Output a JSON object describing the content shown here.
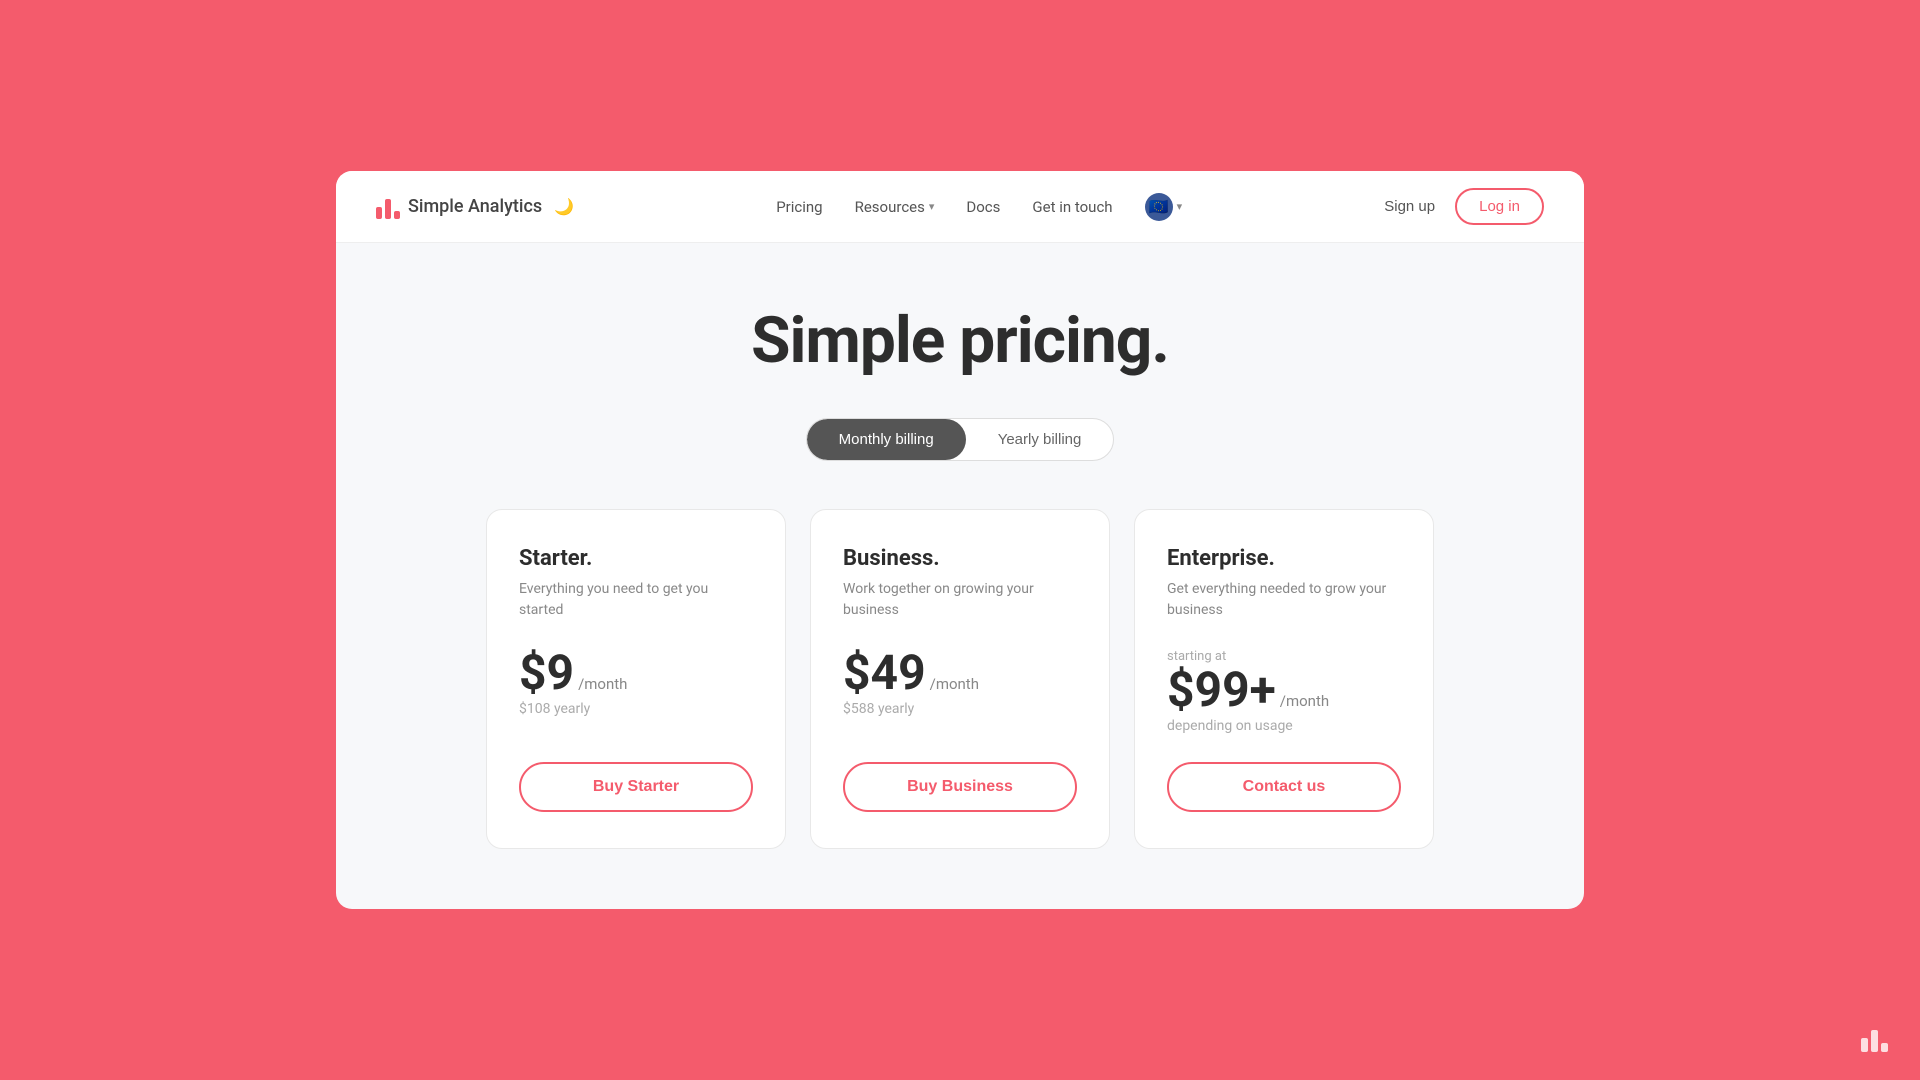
{
  "brand": {
    "name": "Simple Analytics",
    "logo_alt": "Simple Analytics logo"
  },
  "nav": {
    "items": [
      {
        "label": "Pricing",
        "has_dropdown": false
      },
      {
        "label": "Resources",
        "has_dropdown": true
      },
      {
        "label": "Docs",
        "has_dropdown": false
      },
      {
        "label": "Get in touch",
        "has_dropdown": false
      }
    ],
    "language": "🇪🇺",
    "sign_up": "Sign up",
    "log_in": "Log in"
  },
  "page": {
    "title": "Simple pricing."
  },
  "billing_toggle": {
    "monthly_label": "Monthly billing",
    "yearly_label": "Yearly billing",
    "active": "monthly"
  },
  "plans": [
    {
      "name": "Starter.",
      "description": "Everything you need to get you started",
      "price": "$9",
      "period": "/month",
      "yearly_note": "$108 yearly",
      "starting_at": false,
      "depending_on_usage": false,
      "cta": "Buy Starter"
    },
    {
      "name": "Business.",
      "description": "Work together on growing your business",
      "price": "$49",
      "period": "/month",
      "yearly_note": "$588 yearly",
      "starting_at": false,
      "depending_on_usage": false,
      "cta": "Buy Business"
    },
    {
      "name": "Enterprise.",
      "description": "Get everything needed to grow your business",
      "price": "$99+",
      "period": "/month",
      "yearly_note": "depending on usage",
      "starting_at": true,
      "starting_at_label": "starting at",
      "depending_on_usage": true,
      "cta": "Contact us"
    }
  ]
}
